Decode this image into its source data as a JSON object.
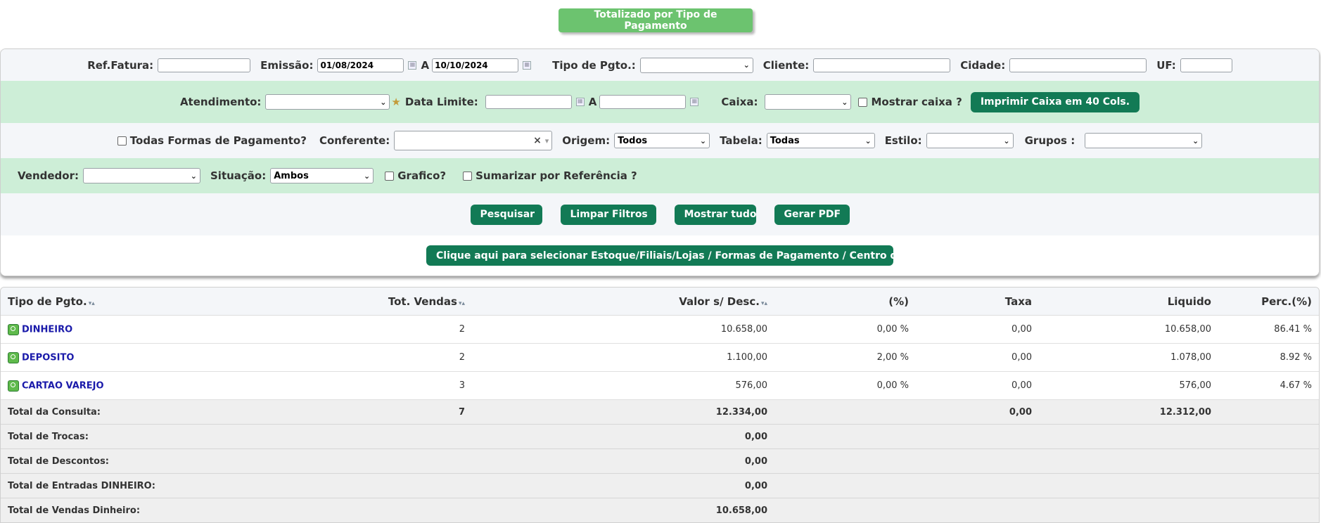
{
  "header": {
    "title_button": "Totalizado por Tipo de Pagamento"
  },
  "filters": {
    "ref_fatura_label": "Ref.Fatura:",
    "ref_fatura_value": "",
    "emissao_label": "Emissão:",
    "emissao_from": "01/08/2024",
    "a_label": "A",
    "emissao_to": "10/10/2024",
    "tipo_pgto_label": "Tipo de Pgto.:",
    "tipo_pgto_value": "",
    "cliente_label": "Cliente:",
    "cidade_label": "Cidade:",
    "uf_label": "UF:",
    "atendimento_label": "Atendimento:",
    "atendimento_value": "",
    "data_limite_label": "Data Limite:",
    "caixa_label": "Caixa:",
    "mostrar_caixa_label": "Mostrar caixa ?",
    "imprimir_button": "Imprimir Caixa em 40 Cols.",
    "todas_formas_label": "Todas Formas de Pagamento?",
    "conferente_label": "Conferente:",
    "conferente_clear": "×",
    "origem_label": "Origem:",
    "origem_value": "Todos",
    "tabela_label": "Tabela:",
    "tabela_value": "Todas",
    "estilo_label": "Estilo:",
    "grupos_label": "Grupos :",
    "vendedor_label": "Vendedor:",
    "situacao_label": "Situação:",
    "situacao_value": "Ambos",
    "grafico_label": "Grafico?",
    "sumarizar_label": "Sumarizar por Referência ?"
  },
  "actions": {
    "pesquisar": "Pesquisar",
    "limpar": "Limpar Filtros",
    "mostrar_tudo": "Mostrar tudo",
    "gerar_pdf": "Gerar PDF",
    "selecionar": "Clique aqui para selecionar Estoque/Filiais/Lojas / Formas de Pagamento / Centro de Custos"
  },
  "table": {
    "columns": [
      "Tipo de Pgto.",
      "Tot. Vendas",
      "Valor s/ Desc.",
      "(%)",
      "Taxa",
      "Liquido",
      "Perc.(%)"
    ],
    "sort_glyph": "▾▴",
    "rows": [
      {
        "tipo": "DINHEIRO",
        "vendas": "2",
        "valor": "10.658,00",
        "pct": "0,00 %",
        "taxa": "0,00",
        "liquido": "10.658,00",
        "perc": "86.41 %"
      },
      {
        "tipo": "DEPOSITO",
        "vendas": "2",
        "valor": "1.100,00",
        "pct": "2,00 %",
        "taxa": "0,00",
        "liquido": "1.078,00",
        "perc": "8.92 %"
      },
      {
        "tipo": "CARTAO VAREJO",
        "vendas": "3",
        "valor": "576,00",
        "pct": "0,00 %",
        "taxa": "0,00",
        "liquido": "576,00",
        "perc": "4.67 %"
      }
    ],
    "totals": [
      {
        "label": "Total da Consulta:",
        "vendas": "7",
        "valor": "12.334,00",
        "taxa": "0,00",
        "liquido": "12.312,00"
      },
      {
        "label": "Total de Trocas:",
        "valor": "0,00"
      },
      {
        "label": "Total de Descontos:",
        "valor": "0,00"
      },
      {
        "label": "Total de Entradas DINHEIRO:",
        "valor": "0,00"
      },
      {
        "label": "Total de Vendas Dinheiro:",
        "valor": "10.658,00"
      }
    ]
  }
}
